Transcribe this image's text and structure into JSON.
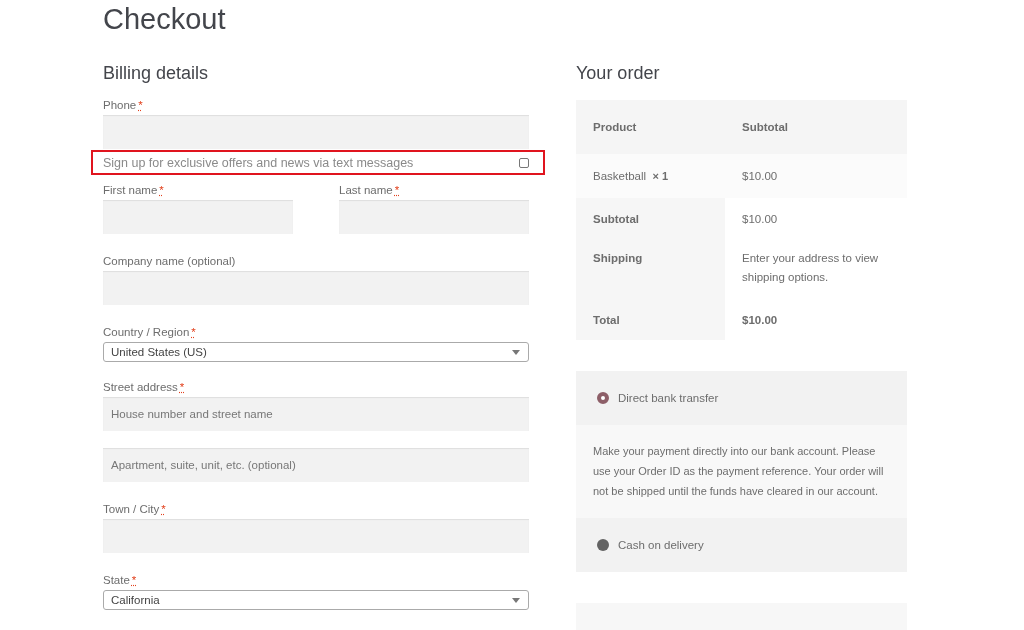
{
  "title": "Checkout",
  "billing": {
    "heading": "Billing details",
    "required_mark": "*",
    "rows": [
      [
        {
          "kind": "text",
          "label": "Phone",
          "required": true
        }
      ],
      [
        {
          "kind": "optin",
          "label": "Sign up for exclusive offers and news via text messages",
          "checked": false
        }
      ],
      [
        {
          "kind": "text",
          "label": "First name",
          "required": true
        },
        {
          "kind": "text",
          "label": "Last name",
          "required": true
        }
      ],
      [
        {
          "kind": "text",
          "label": "Company name (optional)",
          "required": false
        }
      ],
      [
        {
          "kind": "select",
          "label": "Country / Region",
          "required": true,
          "value": "United States (US)"
        }
      ],
      [
        {
          "kind": "text",
          "label": "Street address",
          "required": true,
          "placeholder": "House number and street name"
        }
      ],
      [
        {
          "kind": "text",
          "placeholder": "Apartment, suite, unit, etc. (optional)"
        }
      ],
      [
        {
          "kind": "text",
          "label": "Town / City",
          "required": true
        }
      ],
      [
        {
          "kind": "select",
          "label": "State",
          "required": true,
          "value": "California"
        }
      ]
    ]
  },
  "order": {
    "heading": "Your order",
    "columns": [
      "Product",
      "Subtotal"
    ],
    "items": [
      {
        "product": "Basketball",
        "quantity": "× 1",
        "subtotal": "$10.00"
      }
    ],
    "totals": [
      {
        "label": "Subtotal",
        "value": "$10.00",
        "bold": false
      },
      {
        "label": "Shipping",
        "value": "Enter your address to view shipping options.",
        "bold": false
      },
      {
        "label": "Total",
        "value": "$10.00",
        "bold": true
      }
    ]
  },
  "payment": {
    "methods": [
      {
        "label": "Direct bank transfer",
        "selected": true,
        "description": "Make your payment directly into our bank account. Please use your Order ID as the payment reference. Your order will not be shipped until the funds have cleared in our account."
      },
      {
        "label": "Cash on delivery",
        "selected": false
      }
    ]
  }
}
